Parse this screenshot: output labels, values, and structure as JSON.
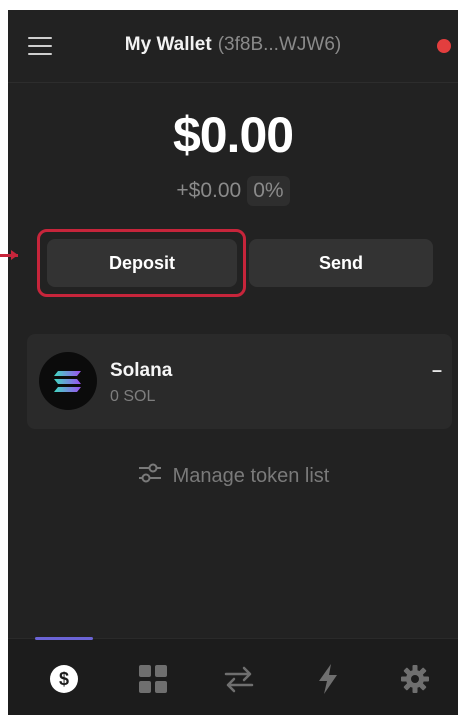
{
  "header": {
    "title": "My Wallet",
    "address": "(3f8B...WJW6)",
    "status_color": "#e33e3e"
  },
  "balance": {
    "total": "$0.00",
    "change": "+$0.00",
    "change_percent": "0%"
  },
  "actions": {
    "deposit_label": "Deposit",
    "send_label": "Send",
    "highlight_color": "#c7253b"
  },
  "tokens": [
    {
      "name": "Solana",
      "amount": "0 SOL",
      "value": "–",
      "icon": "solana-logo-icon"
    }
  ],
  "manage": {
    "label": "Manage token list",
    "icon": "sliders-icon"
  },
  "nav": {
    "items": [
      {
        "icon": "dollar-icon",
        "active": true
      },
      {
        "icon": "grid-icon",
        "active": false
      },
      {
        "icon": "swap-icon",
        "active": false
      },
      {
        "icon": "lightning-icon",
        "active": false
      },
      {
        "icon": "gear-icon",
        "active": false
      }
    ],
    "accent_color": "#6b64d6"
  }
}
